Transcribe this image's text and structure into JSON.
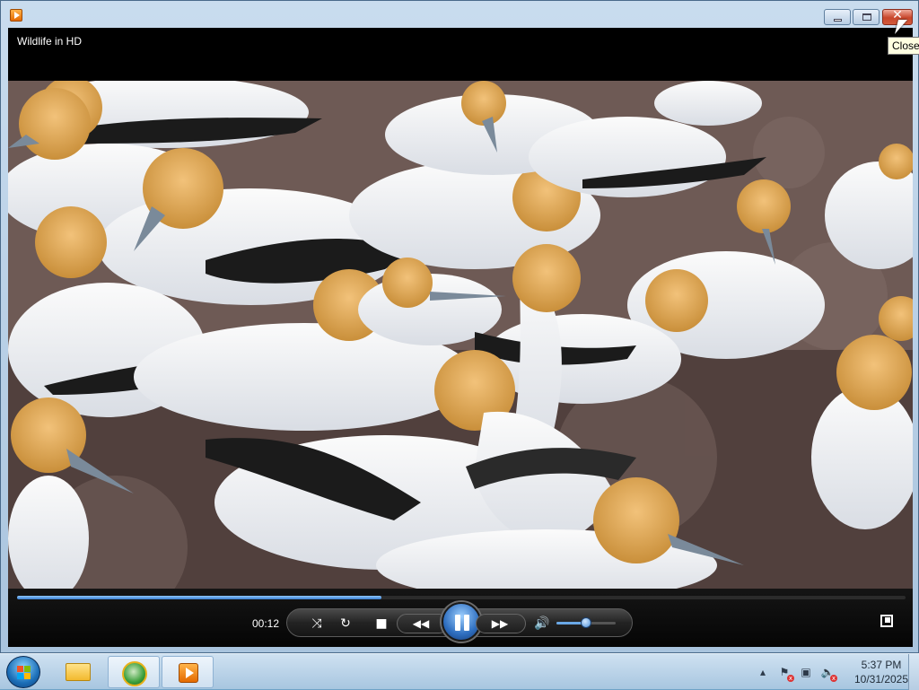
{
  "window": {
    "title": "Wildlife in HD",
    "caption_buttons": {
      "minimize_icon": "minimize-icon",
      "maximize_icon": "maximize-icon",
      "close_glyph": "✕",
      "close_tooltip": "Close"
    }
  },
  "player": {
    "elapsed_time": "00:12",
    "progress_fraction": 0.41,
    "volume_fraction": 0.5,
    "state": "playing",
    "buttons": {
      "shuffle_icon": "shuffle-icon",
      "repeat_icon": "repeat-icon",
      "stop_icon": "stop-icon",
      "previous_icon": "previous-icon",
      "pause_icon": "pause-icon",
      "next_icon": "next-icon",
      "mute_icon": "speaker-icon",
      "fullscreen_icon": "switch-to-library-icon"
    },
    "video_subject": "Colony of northern gannets"
  },
  "taskbar": {
    "start_icon": "windows-start-icon",
    "pinned": [
      "file-explorer-icon",
      "internet-explorer-icon",
      "windows-media-player-icon"
    ],
    "tray_icons": [
      "show-hidden-icons-chevron",
      "action-center-flag-icon",
      "network-icon",
      "volume-muted-icon"
    ],
    "clock_time": "5:37 PM",
    "clock_date": "10/31/2025"
  },
  "colors": {
    "accent_blue": "#3a7fd0",
    "close_red": "#c8462c",
    "player_bg": "#000000",
    "taskbar_bg": "#b8d0e8"
  }
}
